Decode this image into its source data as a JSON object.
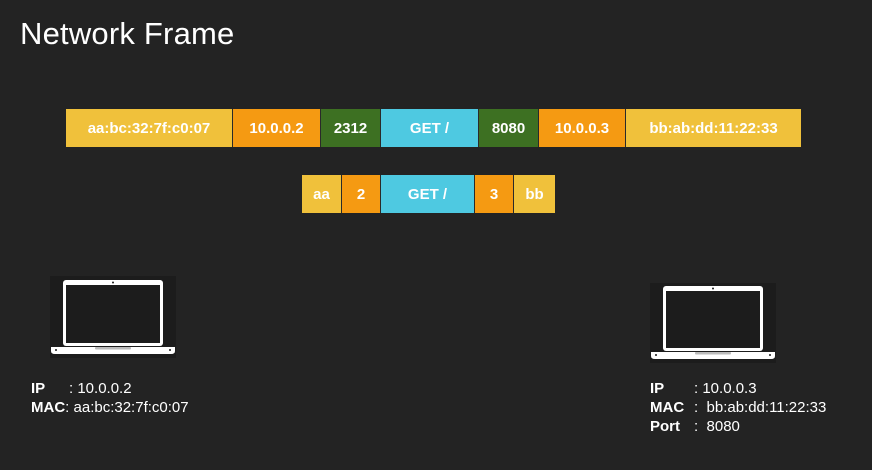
{
  "title": "Network Frame",
  "frame_full": [
    {
      "text": "aa:bc:32:7f:c0:07",
      "kind": "mac"
    },
    {
      "text": "10.0.0.2",
      "kind": "ip"
    },
    {
      "text": "2312",
      "kind": "port"
    },
    {
      "text": "GET /",
      "kind": "data"
    },
    {
      "text": "8080",
      "kind": "port"
    },
    {
      "text": "10.0.0.3",
      "kind": "ip"
    },
    {
      "text": "bb:ab:dd:11:22:33",
      "kind": "mac"
    }
  ],
  "frame_short": [
    {
      "text": "aa",
      "kind": "mac"
    },
    {
      "text": "2",
      "kind": "ip"
    },
    {
      "text": "GET /",
      "kind": "data"
    },
    {
      "text": "3",
      "kind": "ip"
    },
    {
      "text": "bb",
      "kind": "mac"
    }
  ],
  "colors": {
    "mac": "#f0c13b",
    "ip": "#f59a12",
    "port": "#3d7022",
    "data": "#4ec9e1",
    "background": "#232323"
  },
  "host_left": {
    "icon": "laptop-icon",
    "ip_label": "IP",
    "ip_sep": "    : ",
    "ip_value": "10.0.0.2",
    "mac_label": "MAC",
    "mac_sep": ": ",
    "mac_value": "aa:bc:32:7f:c0:07"
  },
  "host_right": {
    "icon": "laptop-icon",
    "ip_label": "IP",
    "ip_sep": "     : ",
    "ip_value": "10.0.0.3",
    "mac_label": "MAC",
    "mac_sep": ":  ",
    "mac_value": "bb:ab:dd:11:22:33",
    "port_label": "Port",
    "port_sep": ":  ",
    "port_value": "8080"
  }
}
